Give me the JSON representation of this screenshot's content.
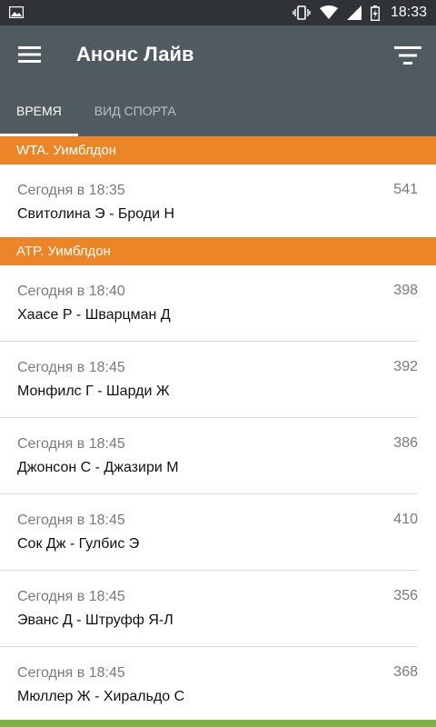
{
  "statusbar": {
    "time": "18:33",
    "icons": [
      "image-icon",
      "vibrate-icon",
      "wifi-icon",
      "signal-icon",
      "battery-charging-icon"
    ]
  },
  "appbar": {
    "title": "Анонс Лайв",
    "menu_icon": "hamburger-menu-icon",
    "filter_icon": "filter-icon",
    "tabs": [
      {
        "label": "ВРЕМЯ",
        "active": true
      },
      {
        "label": "ВИД СПОРТА",
        "active": false
      }
    ]
  },
  "sections": [
    {
      "title": "WTA. Уимблдон",
      "events": [
        {
          "time": "Сегодня в 18:35",
          "match": "Свитолина Э - Броди Н",
          "count": "541"
        }
      ]
    },
    {
      "title": "ATP. Уимблдон",
      "events": [
        {
          "time": "Сегодня в 18:40",
          "match": "Хаасе Р - Шварцман Д",
          "count": "398"
        },
        {
          "time": "Сегодня в 18:45",
          "match": "Монфилс Г - Шарди Ж",
          "count": "392"
        },
        {
          "time": "Сегодня в 18:45",
          "match": "Джонсон С - Джазири М",
          "count": "386"
        },
        {
          "time": "Сегодня в 18:45",
          "match": "Сок Дж - Гулбис Э",
          "count": "410"
        },
        {
          "time": "Сегодня в 18:45",
          "match": "Эванс Д - Штруфф Я-Л",
          "count": "356"
        },
        {
          "time": "Сегодня в 18:45",
          "match": "Мюллер Ж - Хиральдо С",
          "count": "368"
        }
      ]
    }
  ],
  "colors": {
    "appbar": "#4f5a61",
    "statusbar": "#2f3337",
    "section_header": "#ec8527",
    "accent_bottom": "#7cb342"
  }
}
